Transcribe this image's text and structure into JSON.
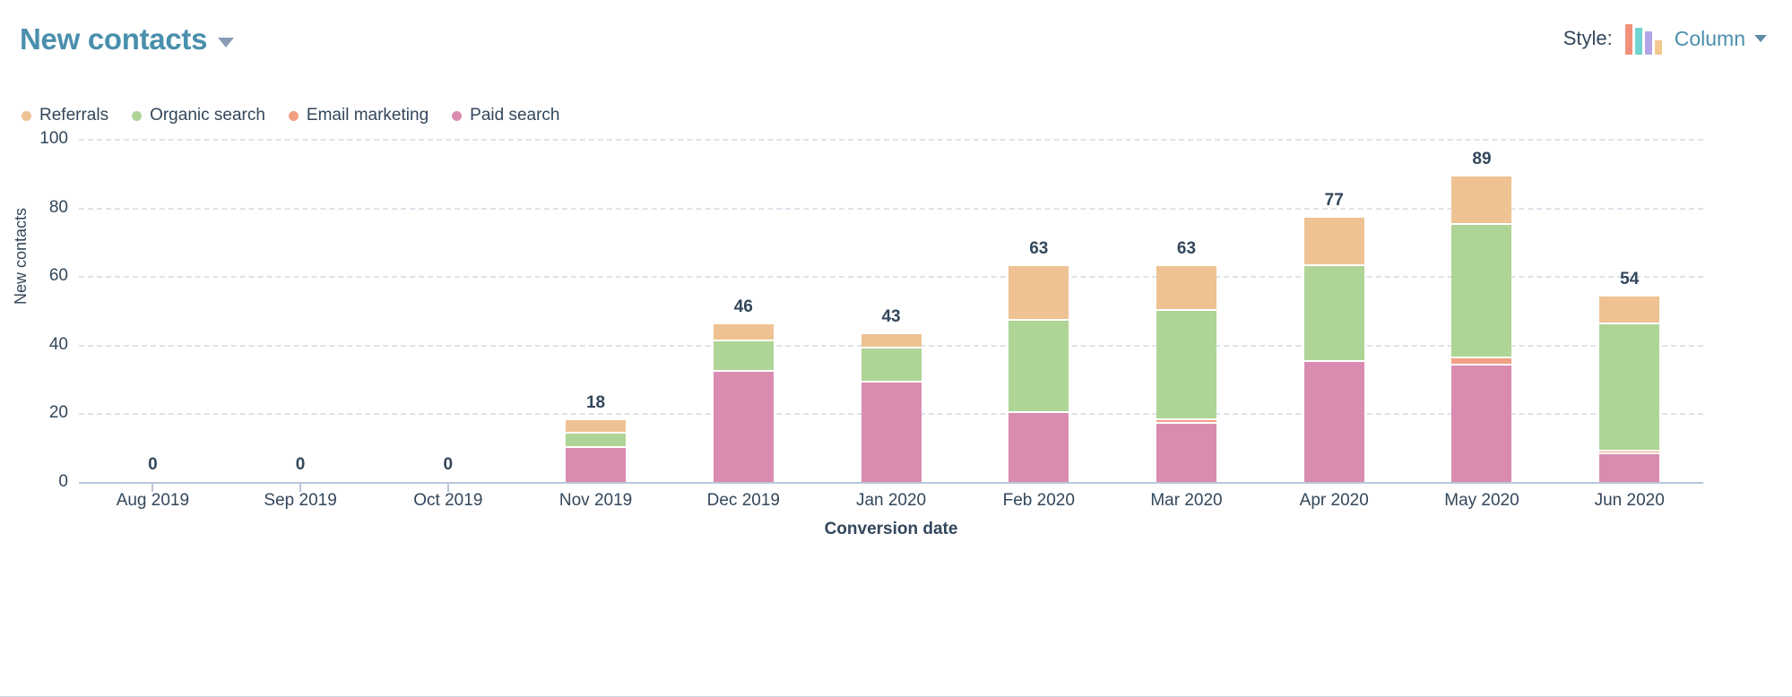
{
  "header": {
    "title": "New contacts",
    "style_label": "Style:",
    "style_value": "Column",
    "style_icon": "column-chart-icon",
    "title_caret_icon": "chevron-down-icon",
    "style_caret_icon": "chevron-down-icon"
  },
  "colors": {
    "title": "#4a8fad",
    "referrals": "#eec292",
    "organic_search": "#aed496",
    "email_marketing": "#f09f83",
    "paid_search": "#d98cb0",
    "text": "#33475b",
    "grid": "#dde3ec",
    "axis": "#b9c8da"
  },
  "chart_data": {
    "type": "bar",
    "title": "New contacts",
    "subtitle": "",
    "stacked": true,
    "xlabel": "Conversion date",
    "ylabel": "New contacts",
    "ylim": [
      0,
      100
    ],
    "yticks": [
      0,
      20,
      40,
      60,
      80,
      100
    ],
    "grid": true,
    "legend_position": "top-left",
    "categories": [
      "Aug 2019",
      "Sep 2019",
      "Oct 2019",
      "Nov 2019",
      "Dec 2019",
      "Jan 2020",
      "Feb 2020",
      "Mar 2020",
      "Apr 2020",
      "May 2020",
      "Jun 2020"
    ],
    "series": [
      {
        "name": "Paid search",
        "color": "#d98cb0",
        "values": [
          0,
          0,
          0,
          10,
          32,
          29,
          20,
          17,
          35,
          34,
          8
        ]
      },
      {
        "name": "Email marketing",
        "color": "#f09f83",
        "values": [
          0,
          0,
          0,
          0,
          0,
          0,
          0,
          1,
          0,
          2,
          1
        ]
      },
      {
        "name": "Organic search",
        "color": "#aed496",
        "values": [
          0,
          0,
          0,
          4,
          9,
          10,
          27,
          32,
          28,
          39,
          37
        ]
      },
      {
        "name": "Referrals",
        "color": "#eec292",
        "values": [
          0,
          0,
          0,
          4,
          5,
          4,
          16,
          13,
          14,
          14,
          8
        ]
      }
    ],
    "totals": [
      0,
      0,
      0,
      18,
      46,
      43,
      63,
      63,
      77,
      89,
      54
    ],
    "total_labels": [
      "0",
      "0",
      "0",
      "18",
      "46",
      "43",
      "63",
      "63",
      "77",
      "89",
      "54"
    ]
  },
  "legend": {
    "items": [
      {
        "label": "Referrals",
        "color": "#eec292"
      },
      {
        "label": "Organic search",
        "color": "#aed496"
      },
      {
        "label": "Email marketing",
        "color": "#f09f83"
      },
      {
        "label": "Paid search",
        "color": "#d98cb0"
      }
    ]
  }
}
